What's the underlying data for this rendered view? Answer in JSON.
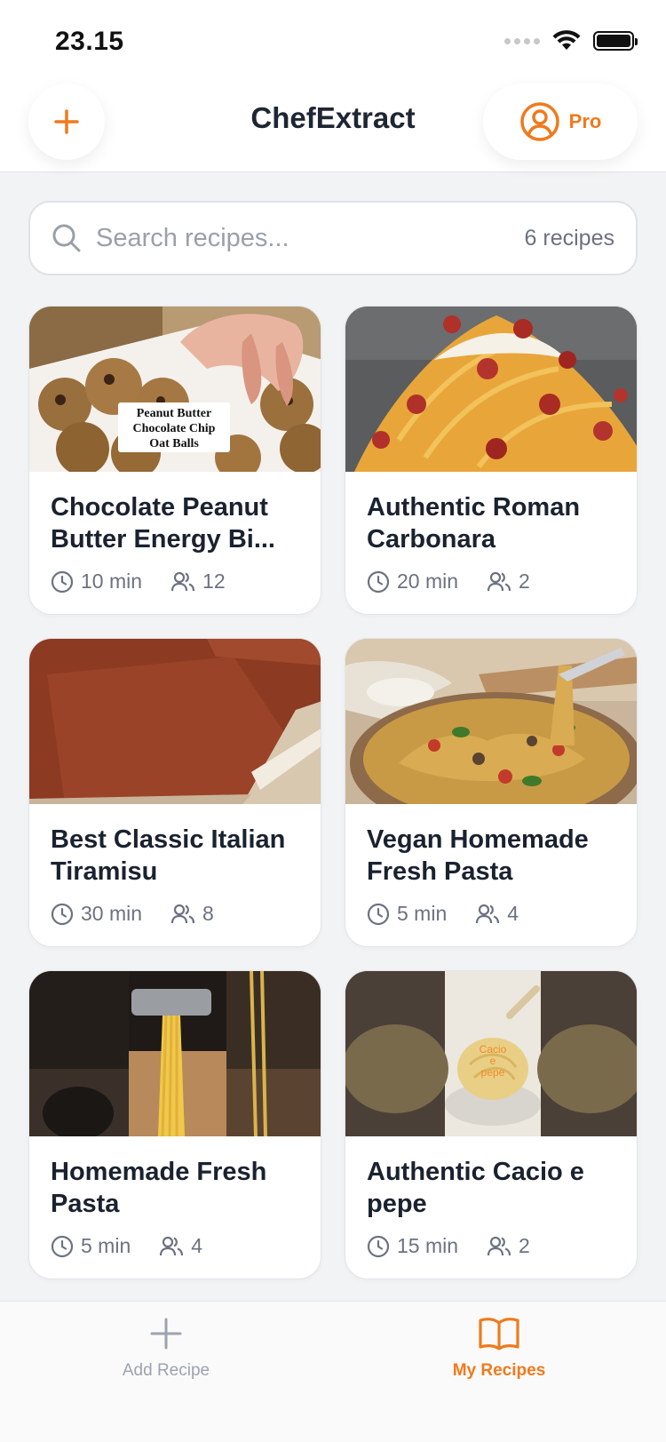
{
  "status_bar": {
    "time": "23.15"
  },
  "header": {
    "title": "ChefExtract",
    "pro_label": "Pro"
  },
  "search": {
    "placeholder": "Search recipes...",
    "count": "6 recipes"
  },
  "colors": {
    "accent": "#f07a1c",
    "background": "#f2f3f5"
  },
  "recipes": [
    {
      "title": "Chocolate Peanut Butter Energy Bi...",
      "time": "10 min",
      "servings": "12",
      "thumb_caption": "Peanut Butter Chocolate Chip Oat Balls"
    },
    {
      "title": "Authentic Roman Carbonara",
      "time": "20 min",
      "servings": "2"
    },
    {
      "title": "Best Classic Italian Tiramisu",
      "time": "30 min",
      "servings": "8"
    },
    {
      "title": "Vegan Homemade Fresh Pasta",
      "time": "5 min",
      "servings": "4"
    },
    {
      "title": "Homemade Fresh Pasta",
      "time": "5 min",
      "servings": "4"
    },
    {
      "title": "Authentic Cacio e pepe",
      "time": "15 min",
      "servings": "2",
      "thumb_caption": "Cacio e pepe"
    }
  ],
  "tabbar": {
    "add_label": "Add Recipe",
    "recipes_label": "My Recipes"
  }
}
